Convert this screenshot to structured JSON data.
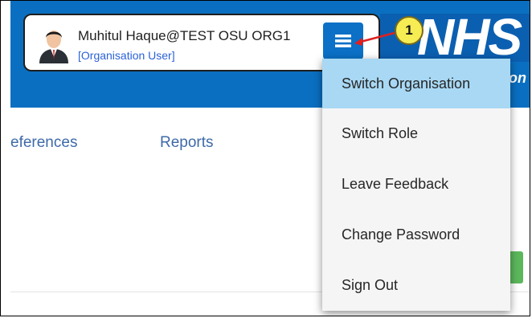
{
  "user": {
    "name": "Muhitul Haque@TEST OSU ORG1",
    "role": "[Organisation User]"
  },
  "brand": {
    "logo_text": "NHS",
    "sub_text_fragment": "on"
  },
  "nav": {
    "items": [
      {
        "label": "eferences"
      },
      {
        "label": "Reports"
      }
    ]
  },
  "dropdown": {
    "items": [
      {
        "label": "Switch Organisation",
        "active": true
      },
      {
        "label": "Switch Role"
      },
      {
        "label": "Leave Feedback"
      },
      {
        "label": "Change Password"
      },
      {
        "label": "Sign Out"
      }
    ]
  },
  "callout": {
    "number": "1"
  },
  "colors": {
    "header_blue": "#0a6fc0",
    "nhs_blue": "#0b5fb0",
    "active_highlight": "#a8d8f4",
    "callout_yellow": "#f6ec53",
    "arrow_red": "#e02020",
    "green_button": "#5cb85c"
  },
  "icons": {
    "avatar": "user-avatar-icon",
    "menu": "hamburger-menu-icon"
  }
}
